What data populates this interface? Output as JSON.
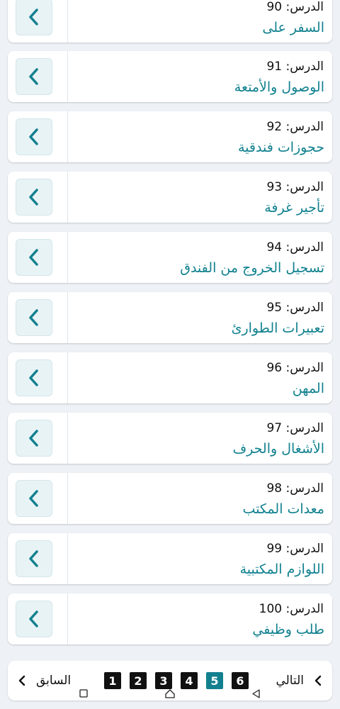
{
  "lessons": [
    {
      "number_label": "الدرس: 90",
      "title": "السفر على"
    },
    {
      "number_label": "الدرس: 91",
      "title": "الوصول والأمتعة"
    },
    {
      "number_label": "الدرس: 92",
      "title": "حجوزات فندقية"
    },
    {
      "number_label": "الدرس: 93",
      "title": "تأجير غرفة"
    },
    {
      "number_label": "الدرس: 94",
      "title": "تسجيل الخروج من الفندق"
    },
    {
      "number_label": "الدرس: 95",
      "title": "تعبيرات الطوارئ"
    },
    {
      "number_label": "الدرس: 96",
      "title": "المهن"
    },
    {
      "number_label": "الدرس: 97",
      "title": "الأشغال والحرف"
    },
    {
      "number_label": "الدرس: 98",
      "title": "معدات المكتب"
    },
    {
      "number_label": "الدرس: 99",
      "title": "اللوازم المكتبية"
    },
    {
      "number_label": "الدرس: 100",
      "title": "طلب وظيفي"
    }
  ],
  "pagination": {
    "prev_label": "السابق",
    "next_label": "التالي",
    "pages": [
      "1",
      "2",
      "3",
      "4",
      "5",
      "6"
    ],
    "current_page": "5"
  },
  "colors": {
    "accent": "#13808f",
    "title_text": "#11818f",
    "button_bg": "#e8f3f6"
  },
  "icons": {
    "lesson_button": "chevron-left-icon",
    "prev": "chevron-left-icon",
    "next": "chevron-left-icon",
    "nav_recents": "square-icon",
    "nav_home": "home-icon",
    "nav_back": "triangle-back-icon"
  }
}
